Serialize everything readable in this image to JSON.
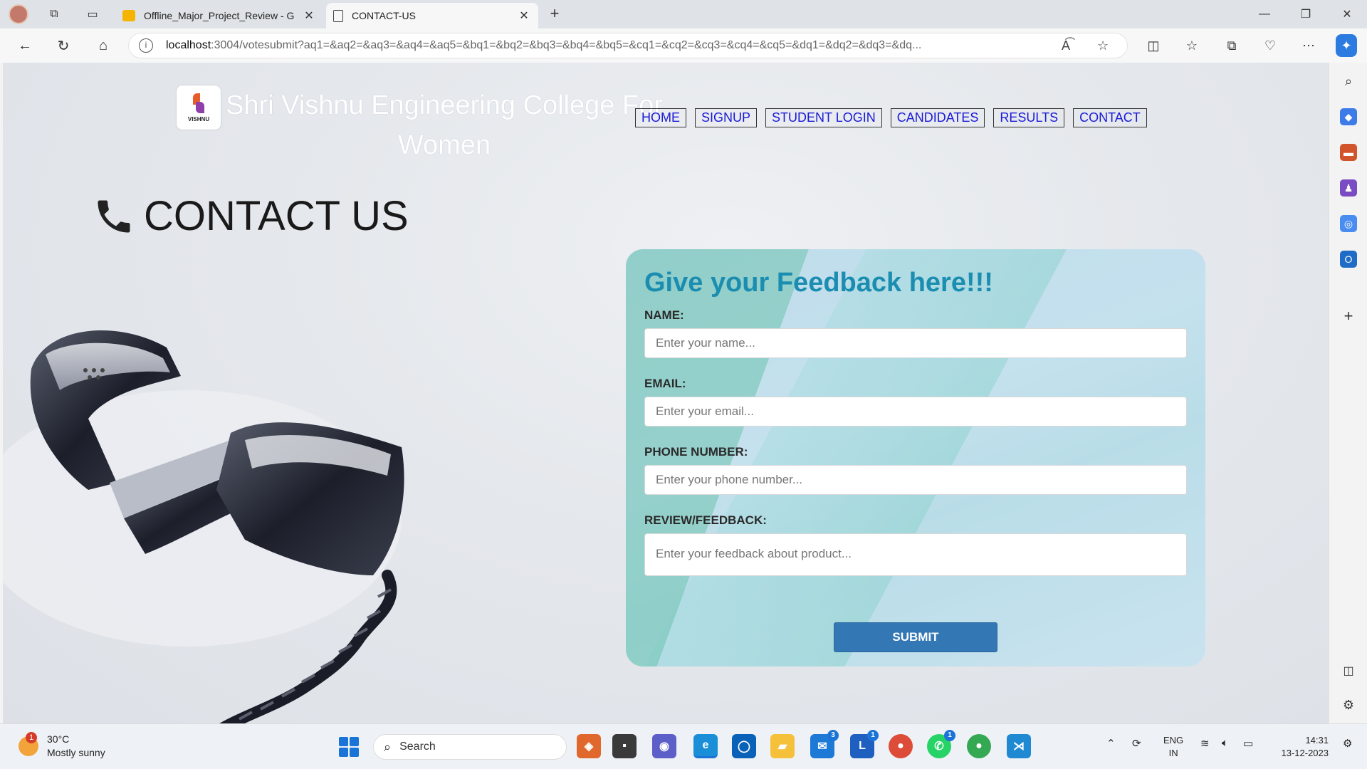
{
  "browser": {
    "tabs": [
      {
        "title": "Offline_Major_Project_Review - G",
        "active": false
      },
      {
        "title": "CONTACT-US",
        "active": true
      }
    ],
    "url_host": "localhost",
    "url_rest": ":3004/votesubmit?aq1=&aq2=&aq3=&aq4=&aq5=&bq1=&bq2=&bq3=&bq4=&bq5=&cq1=&cq2=&cq3=&cq4=&cq5=&dq1=&dq2=&dq3=&dq..."
  },
  "site": {
    "logo_text": "VISHNU",
    "title": "Shri Vishnu Engineering College For Women",
    "nav": [
      "HOME",
      "SIGNUP",
      "STUDENT LOGIN",
      "CANDIDATES",
      "RESULTS",
      "CONTACT"
    ]
  },
  "page": {
    "heading": "CONTACT US"
  },
  "form": {
    "title": "Give your Feedback here!!!",
    "name_label": "NAME:",
    "name_placeholder": "Enter your name...",
    "email_label": "EMAIL:",
    "email_placeholder": "Enter your email...",
    "phone_label": "PHONE NUMBER:",
    "phone_placeholder": "Enter your phone number...",
    "feedback_label": "REVIEW/FEEDBACK:",
    "feedback_placeholder": "Enter your feedback about product...",
    "submit_label": "SUBMIT"
  },
  "taskbar": {
    "weather_badge": "1",
    "temperature": "30°C",
    "condition": "Mostly sunny",
    "search_label": "Search",
    "mail_badge": "3",
    "teams_badge": "1",
    "whatsapp_badge": "1",
    "lang_line1": "ENG",
    "lang_line2": "IN",
    "time": "14:31",
    "date": "13-12-2023"
  },
  "colors": {
    "form_title": "#1b8db0",
    "submit_bg": "#3377b5",
    "nav_link": "#1a1ad6"
  }
}
